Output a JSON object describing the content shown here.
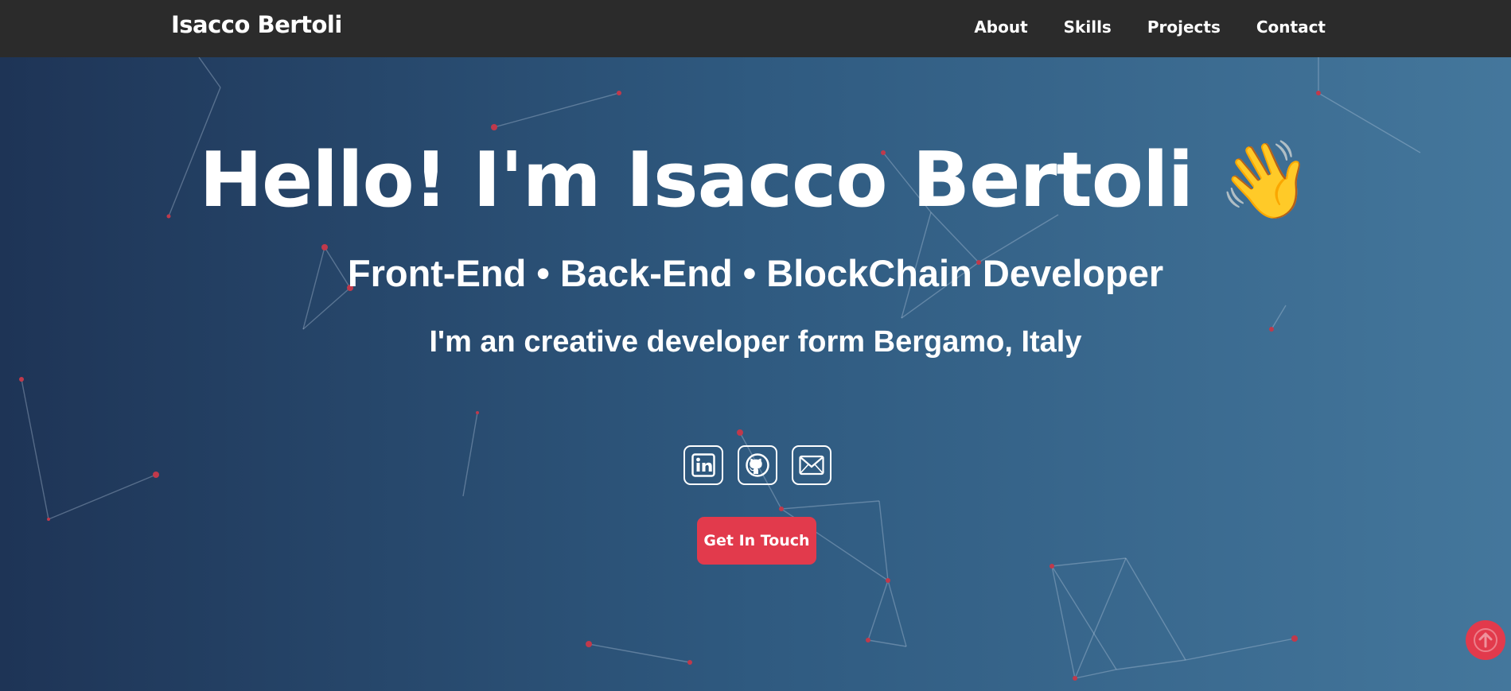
{
  "nav": {
    "brand": "Isacco Bertoli",
    "links": [
      "About",
      "Skills",
      "Projects",
      "Contact"
    ]
  },
  "hero": {
    "title": "Hello! I'm Isacco Bertoli",
    "wave_emoji": "👋",
    "subtitle": "Front-End • Back-End • BlockChain Developer",
    "tagline": "I'm an creative developer form Bergamo, Italy",
    "cta_label": "Get In Touch"
  },
  "socials": [
    {
      "name": "linkedin",
      "icon": "linkedin-icon"
    },
    {
      "name": "github",
      "icon": "github-icon"
    },
    {
      "name": "email",
      "icon": "mail-icon"
    }
  ],
  "colors": {
    "navbar": "#2b2b2b",
    "accent": "#e23a4c",
    "gradient_start": "#1e3456",
    "gradient_end": "#44779c"
  }
}
